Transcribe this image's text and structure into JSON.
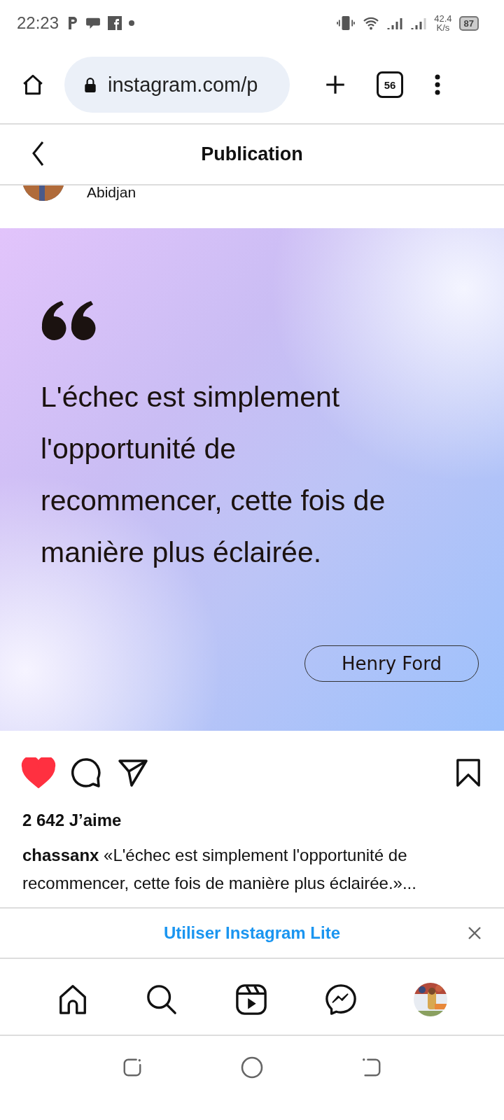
{
  "status_bar": {
    "time": "22:23",
    "speed": "42.4",
    "speed_unit": "K/s",
    "battery": "87"
  },
  "browser": {
    "url": "instagram.com/p",
    "tab_count": "56"
  },
  "header": {
    "title": "Publication"
  },
  "post": {
    "location": "Abidjan",
    "quote": "L'échec est simplement l'opportunité de recommencer, cette fois de manière plus éclairée.",
    "author": "Henry Ford",
    "liked": true,
    "saved": false,
    "likes": "2 642 J’aime",
    "username": "chassanx",
    "caption": "«L'échec est simplement l'opportunité de recommencer, cette fois de manière plus éclairée.»..."
  },
  "banner": {
    "label": "Utiliser Instagram Lite"
  }
}
